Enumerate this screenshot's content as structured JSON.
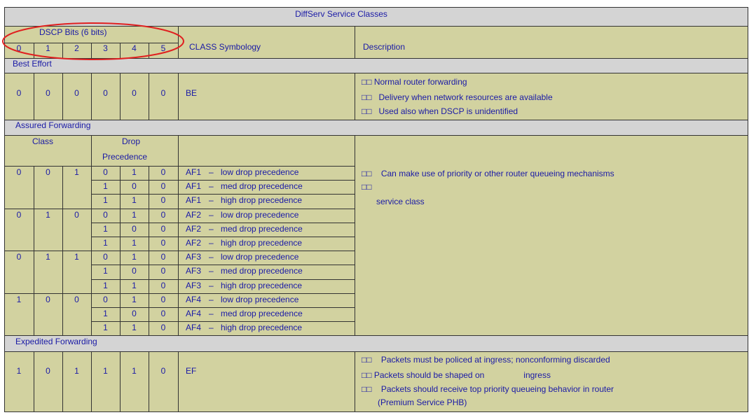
{
  "title": "DiffServ Service Classes",
  "header": {
    "dscp_label": "DSCP Bits (6 bits)",
    "bits": [
      "0",
      "1",
      "2",
      "3",
      "4",
      "5"
    ],
    "class_symbology": "CLASS Symbology",
    "description": "Description"
  },
  "best_effort": {
    "section": "Best Effort",
    "bits": [
      "0",
      "0",
      "0",
      "0",
      "0",
      "0"
    ],
    "symbol": "BE",
    "descriptions": [
      "Normal router forwarding",
      "Delivery when network resources are available",
      "Used also when DSCP is unidentified"
    ]
  },
  "assured_forwarding": {
    "section": "Assured Forwarding",
    "class_label": "Class",
    "drop_label_1": "Drop",
    "drop_label_2": "Precedence",
    "rows": [
      {
        "c": [
          "0",
          "0",
          "1"
        ],
        "d": [
          "0",
          "1",
          "0"
        ],
        "sym": "AF1",
        "desc": "low drop precedence"
      },
      {
        "c": [
          "",
          "",
          ""
        ],
        "d": [
          "1",
          "0",
          "0"
        ],
        "sym": "AF1",
        "desc": "med drop precedence"
      },
      {
        "c": [
          "",
          "",
          ""
        ],
        "d": [
          "1",
          "1",
          "0"
        ],
        "sym": "AF1",
        "desc": "high drop precedence"
      },
      {
        "c": [
          "0",
          "1",
          "0"
        ],
        "d": [
          "0",
          "1",
          "0"
        ],
        "sym": "AF2",
        "desc": "low drop precedence"
      },
      {
        "c": [
          "",
          "",
          ""
        ],
        "d": [
          "1",
          "0",
          "0"
        ],
        "sym": "AF2",
        "desc": "med drop precedence"
      },
      {
        "c": [
          "",
          "",
          ""
        ],
        "d": [
          "1",
          "1",
          "0"
        ],
        "sym": "AF2",
        "desc": "high drop precedence"
      },
      {
        "c": [
          "0",
          "1",
          "1"
        ],
        "d": [
          "0",
          "1",
          "0"
        ],
        "sym": "AF3",
        "desc": "low drop precedence"
      },
      {
        "c": [
          "",
          "",
          ""
        ],
        "d": [
          "1",
          "0",
          "0"
        ],
        "sym": "AF3",
        "desc": "med drop precedence"
      },
      {
        "c": [
          "",
          "",
          ""
        ],
        "d": [
          "1",
          "1",
          "0"
        ],
        "sym": "AF3",
        "desc": "high drop precedence"
      },
      {
        "c": [
          "1",
          "0",
          "0"
        ],
        "d": [
          "0",
          "1",
          "0"
        ],
        "sym": "AF4",
        "desc": "low drop precedence"
      },
      {
        "c": [
          "",
          "",
          ""
        ],
        "d": [
          "1",
          "0",
          "0"
        ],
        "sym": "AF4",
        "desc": "med drop precedence"
      },
      {
        "c": [
          "",
          "",
          ""
        ],
        "d": [
          "1",
          "1",
          "0"
        ],
        "sym": "AF4",
        "desc": "high drop precedence"
      }
    ],
    "dash": "–",
    "desc_1": "Can make use of priority or other router queueing mechanisms",
    "desc_3": "service class"
  },
  "expedited_forwarding": {
    "section": "Expedited Forwarding",
    "bits": [
      "1",
      "0",
      "1",
      "1",
      "1",
      "0"
    ],
    "symbol": "EF",
    "desc_1": "Packets must be policed at ingress; nonconforming  discarded",
    "desc_2a": "Packets should be shaped on",
    "desc_2b": "ingress",
    "desc_3": "Packets should receive top priority queueing behavior in router",
    "desc_4": "(Premium Service PHB)"
  },
  "bullet": "□□",
  "colors": {
    "olive": "#d2d2a0",
    "band": "#d4d4d4",
    "text": "#1a1aa6",
    "highlight_ellipse": "#e02020"
  }
}
